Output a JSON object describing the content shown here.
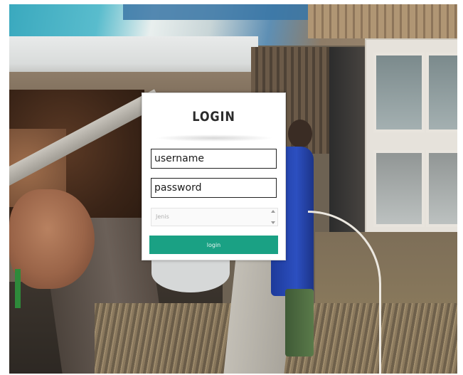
{
  "login": {
    "title": "LOGIN",
    "username_placeholder": "username",
    "password_placeholder": "password",
    "role_select_value": "Jenis",
    "submit_label": "login"
  },
  "colors": {
    "button": "#1aa184",
    "panel_background": "#ffffff",
    "field_border": "#222222"
  }
}
